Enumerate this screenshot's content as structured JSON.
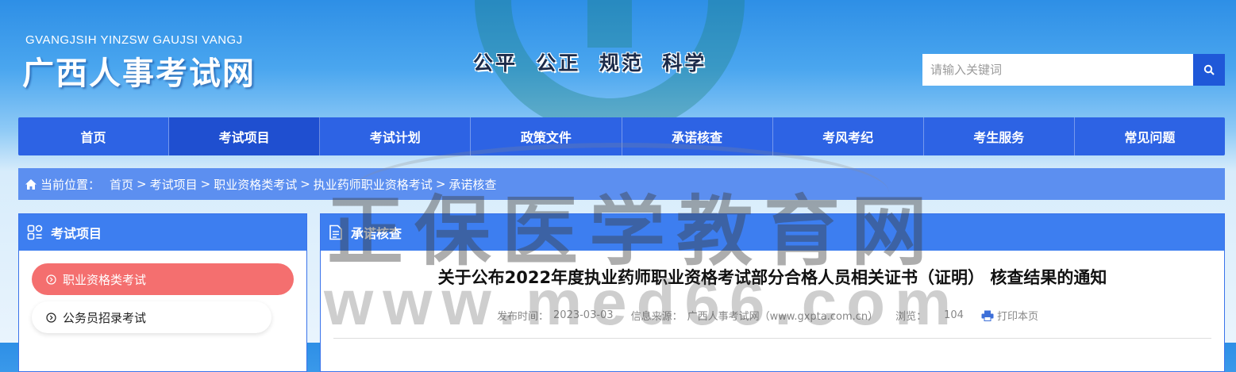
{
  "header": {
    "subtitle": "GVANGJSIH YINZSW GAUJSI VANGJ",
    "title": "广西人事考试网",
    "slogan": "公平  公正  规范  科学"
  },
  "search": {
    "placeholder": "请输入关键词",
    "icon": "search-icon"
  },
  "nav": {
    "items": [
      {
        "label": "首页"
      },
      {
        "label": "考试项目"
      },
      {
        "label": "考试计划"
      },
      {
        "label": "政策文件"
      },
      {
        "label": "承诺核查"
      },
      {
        "label": "考风考纪"
      },
      {
        "label": "考生服务"
      },
      {
        "label": "常见问题"
      }
    ],
    "active_index": 1
  },
  "breadcrumb": {
    "label": "当前位置：",
    "items": [
      "首页",
      "考试项目",
      "职业资格类考试",
      "执业药师职业资格考试",
      "承诺核查"
    ],
    "separator": ">"
  },
  "sidebar": {
    "title": "考试项目",
    "items": [
      {
        "label": "职业资格类考试",
        "active": true
      },
      {
        "label": "公务员招录考试",
        "active": false
      }
    ]
  },
  "main": {
    "panel_title": "承诺核查",
    "article": {
      "title": "关于公布2022年度执业药师职业资格考试部分合格人员相关证书（证明） 核查结果的通知",
      "publish_label": "发布时间：",
      "publish_date": "2023-03-03",
      "source_label": "信息来源：",
      "source": "广西人事考试网（www.gxpta.com.cn）",
      "views_label": "浏览：",
      "views": "104",
      "print_label": "打印本页"
    }
  },
  "watermark": {
    "text1": "正保医学教育网",
    "text2": "www.med66.com"
  },
  "colors": {
    "nav": "#2d63e4",
    "nav_active": "#1f4fd0",
    "breadcrumb": "#5c8ff0",
    "panel_head": "#3d7ef0",
    "sidebar_active": "#f46f6f",
    "search_button": "#1f58d8"
  }
}
